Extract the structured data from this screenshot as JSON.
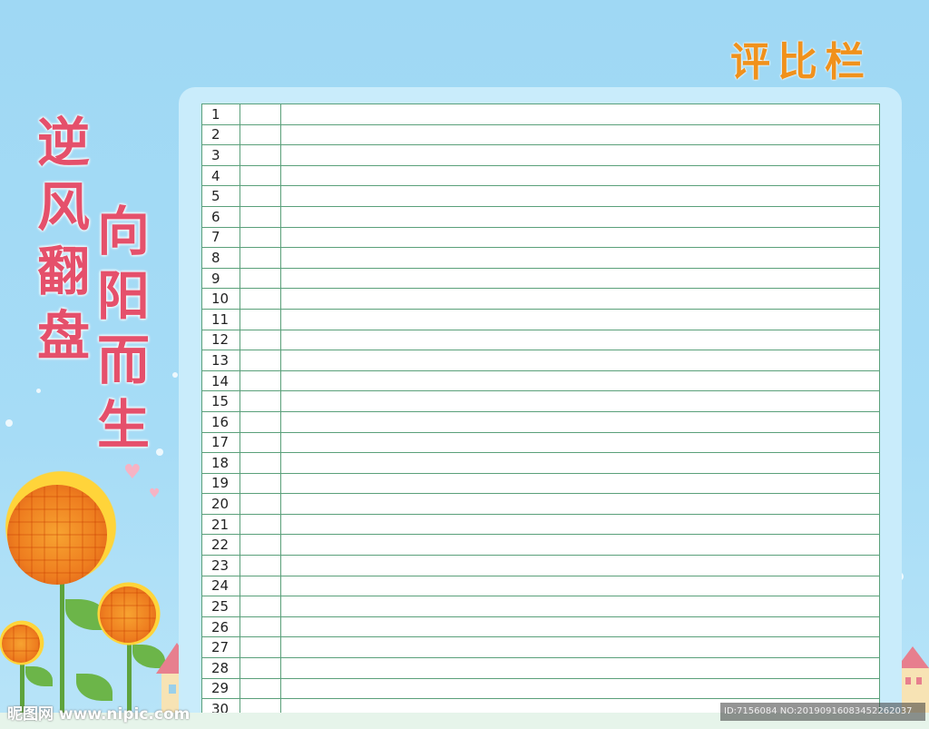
{
  "header": {
    "title": "评比栏"
  },
  "slogan": {
    "column1": [
      "逆",
      "风",
      "翻",
      "盘"
    ],
    "column2": [
      "向",
      "阳",
      "而",
      "生"
    ]
  },
  "sheet": {
    "rows": [
      "1",
      "2",
      "3",
      "4",
      "5",
      "6",
      "7",
      "8",
      "9",
      "10",
      "11",
      "12",
      "13",
      "14",
      "15",
      "16",
      "17",
      "18",
      "19",
      "20",
      "21",
      "22",
      "23",
      "24",
      "25",
      "26",
      "27",
      "28",
      "29",
      "30"
    ]
  },
  "footer": {
    "watermark": "昵图网 www.nipic.com",
    "id_tag": "ID:7156084 NO:20190916083452262037"
  },
  "colors": {
    "background": "#a6dcf6",
    "title": "#f0911c",
    "slogan": "#e5506b",
    "grid_line": "#5aa07a",
    "panel": "#c9ecfb"
  },
  "icons": [
    "sunflower-icon",
    "house-icon",
    "heart-icon",
    "sparkle-icon"
  ]
}
